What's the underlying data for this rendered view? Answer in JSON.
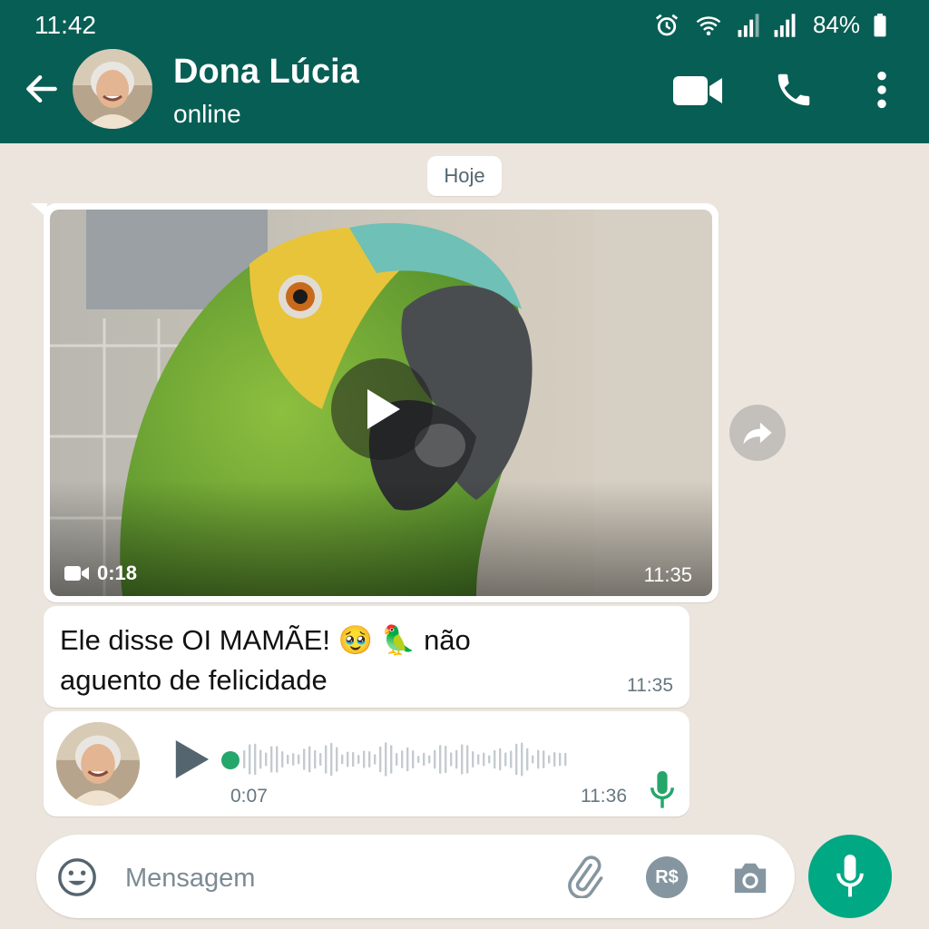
{
  "status_bar": {
    "time": "11:42",
    "battery": "84%",
    "icons": [
      "alarm-icon",
      "wifi-icon",
      "signal-icon",
      "signal-icon",
      "battery-icon"
    ]
  },
  "header": {
    "contact_name": "Dona Lúcia",
    "contact_status": "online",
    "icons": [
      "back-arrow-icon",
      "video-call-icon",
      "phone-icon",
      "more-vert-icon"
    ],
    "color": "#075e54"
  },
  "chat": {
    "date_chip": "Hoje",
    "video_message": {
      "duration": "0:18",
      "time": "11:35"
    },
    "text_message": {
      "text": "Ele disse OI MAMÃE! 🥹 🦜  não aguento de felicidade",
      "time": "11:35"
    },
    "voice_message": {
      "duration": "0:07",
      "time": "11:36"
    }
  },
  "input": {
    "placeholder": "Mensagem",
    "pay_label": "R$",
    "icons": [
      "emoji-icon",
      "attach-icon",
      "payment-icon",
      "camera-icon",
      "mic-icon"
    ],
    "accent": "#00a884"
  }
}
